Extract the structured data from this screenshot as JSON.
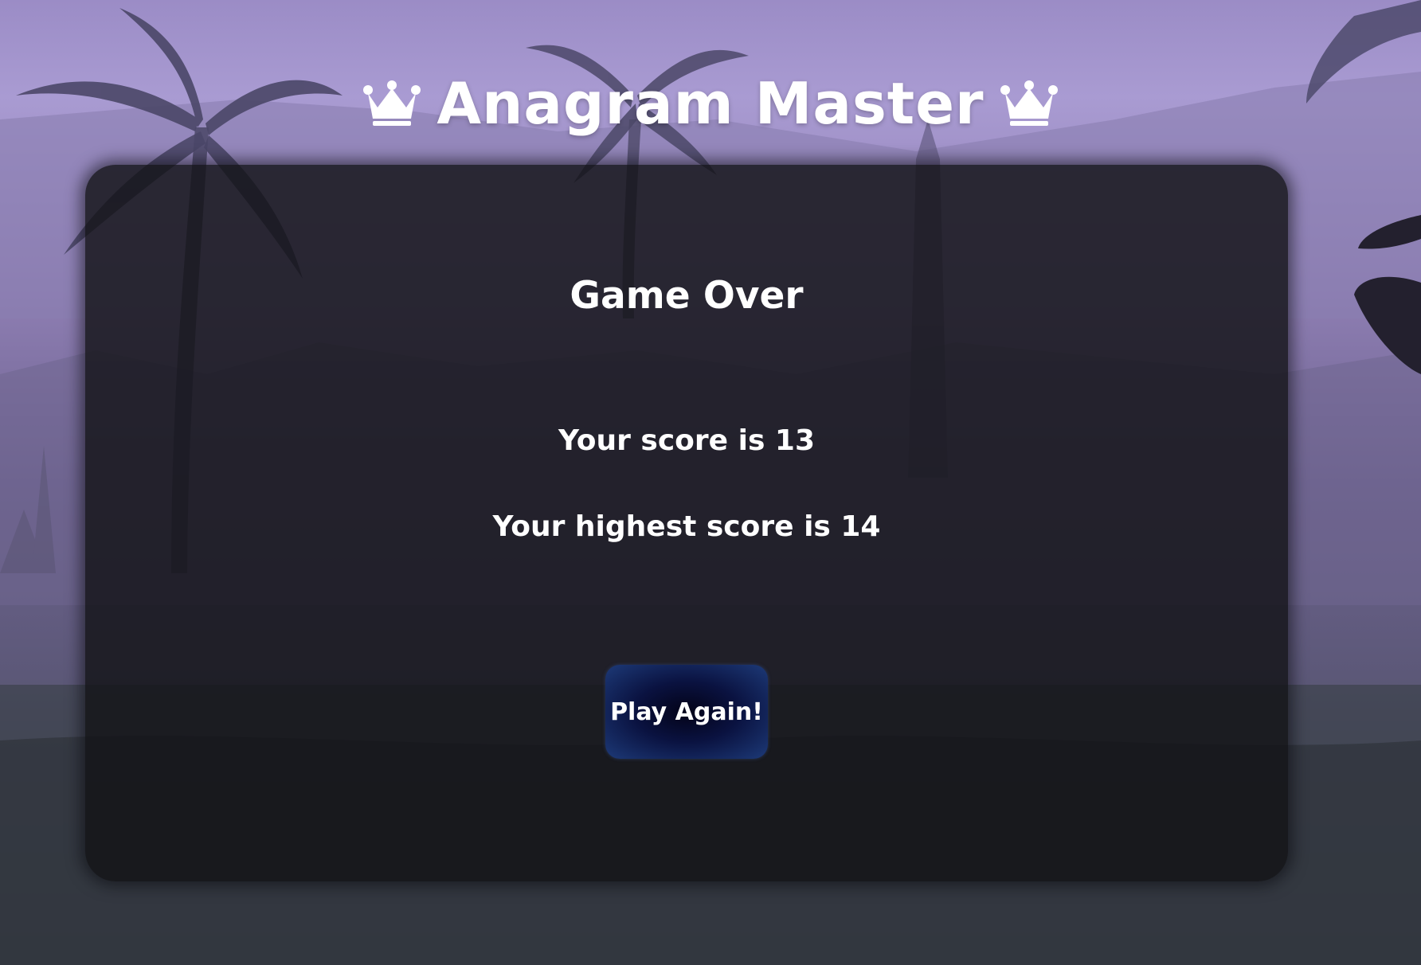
{
  "header": {
    "title": "Anagram Master",
    "left_icon": "crown-icon",
    "right_icon": "crown-icon"
  },
  "result": {
    "heading": "Game Over",
    "score_text": "Your score is 13",
    "high_score_text": "Your highest score is 14"
  },
  "actions": {
    "play_again_label": "Play Again!"
  },
  "colors": {
    "text": "#ffffff",
    "panel": "#121216",
    "button_center": "#030318",
    "button_edge": "#1d3a78",
    "sky_top": "#9b8cc6",
    "ground": "#383c44"
  }
}
